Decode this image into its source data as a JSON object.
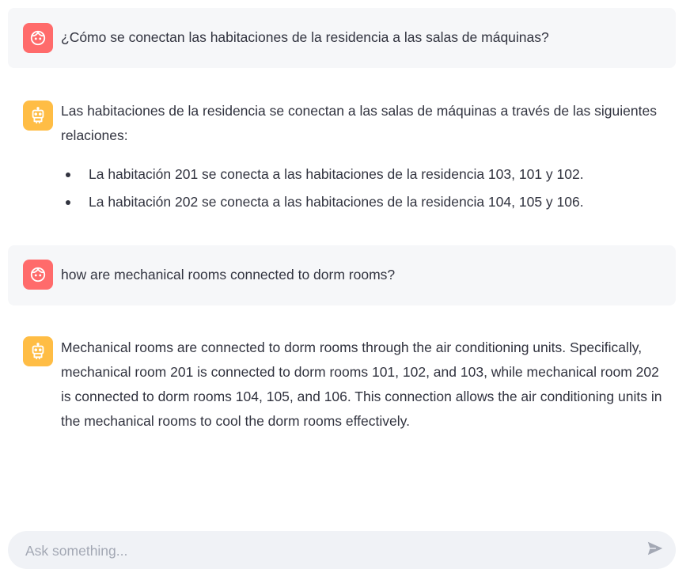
{
  "messages": [
    {
      "role": "user",
      "avatar_icon": "user-face-icon",
      "text": "¿Cómo se conectan las habitaciones de la residencia a las salas de máquinas?"
    },
    {
      "role": "assistant",
      "avatar_icon": "robot-icon",
      "text": "Las habitaciones de la residencia se conectan a las salas de máquinas a través de las siguientes relaciones:",
      "bullets": [
        "La habitación 201 se conecta a las habitaciones de la residencia 103, 101 y 102.",
        "La habitación 202 se conecta a las habitaciones de la residencia 104, 105 y 106."
      ]
    },
    {
      "role": "user",
      "avatar_icon": "user-face-icon",
      "text": "how are mechanical rooms connected to dorm rooms?"
    },
    {
      "role": "assistant",
      "avatar_icon": "robot-icon",
      "text": "Mechanical rooms are connected to dorm rooms through the air conditioning units. Specifically, mechanical room 201 is connected to dorm rooms 101, 102, and 103, while mechanical room 202 is connected to dorm rooms 104, 105, and 106. This connection allows the air conditioning units in the mechanical rooms to cool the dorm rooms effectively."
    }
  ],
  "chat_input": {
    "placeholder": "Ask something...",
    "value": "",
    "send_icon": "send-icon"
  },
  "colors": {
    "user_avatar": "#ff6b6b",
    "assistant_avatar": "#ffbd45",
    "user_bubble": "#f6f7f9",
    "input_bg": "#f0f2f6",
    "text": "#31333f",
    "placeholder": "#a3a8b4"
  }
}
